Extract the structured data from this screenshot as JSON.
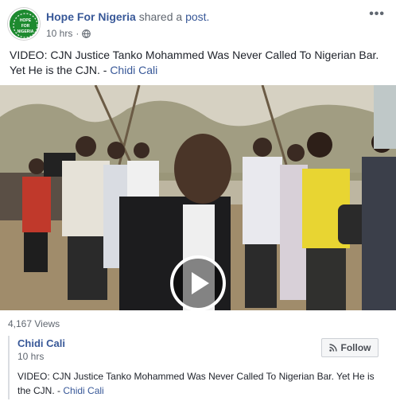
{
  "post": {
    "author": "Hope For Nigeria",
    "shared_word": "shared a",
    "shared_link": "post.",
    "time": "10 hrs",
    "dot": "·",
    "text": "VIDEO: CJN Justice Tanko Mohammed Was Never Called To Nigerian Bar. Yet He is the CJN. -",
    "text_link": "Chidi Cali",
    "views": "4,167 Views",
    "avatar_text_top": "HOPE",
    "avatar_text_mid": "FOR",
    "avatar_text_bot": "NIGERIA"
  },
  "shared": {
    "author": "Chidi Cali",
    "time": "10 hrs",
    "follow_label": "Follow",
    "text": "VIDEO: CJN Justice Tanko Mohammed Was Never Called To Nigerian Bar. Yet He is the CJN. -",
    "text_link": "Chidi Cali"
  },
  "icons": {
    "more": "more-icon",
    "globe": "globe-icon",
    "play": "play-icon",
    "follow": "rss-icon"
  },
  "colors": {
    "link": "#385898",
    "text": "#1d2129",
    "meta": "#606770",
    "avatar_green": "#1d8a2f"
  }
}
